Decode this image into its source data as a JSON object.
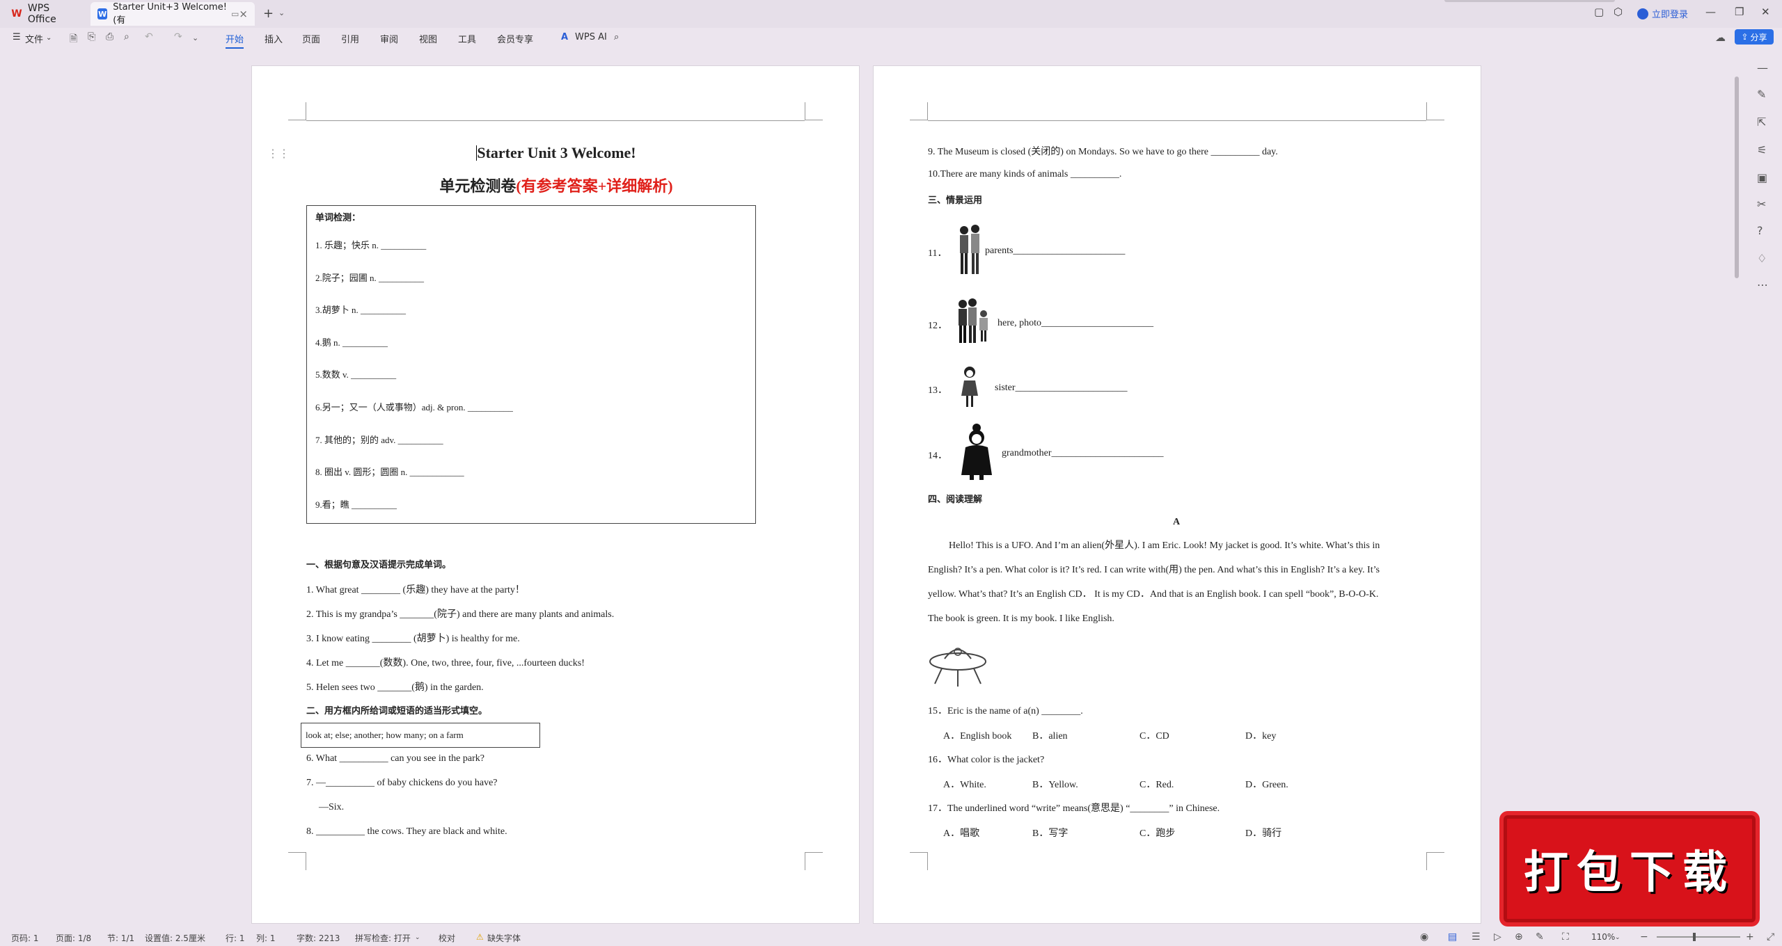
{
  "titlebar": {
    "app_tab": "WPS Office",
    "doc_tab": "Starter Unit+3 Welcome! (有",
    "login": "立即登录"
  },
  "menubar": {
    "file": "文件",
    "tabs": [
      "开始",
      "插入",
      "页面",
      "引用",
      "审阅",
      "视图",
      "工具",
      "会员专享"
    ],
    "active_tab": "开始",
    "wps_ai": "WPS AI",
    "share": "分享"
  },
  "page1": {
    "title": "Starter Unit 3 Welcome!",
    "subtitle_black": "单元检测卷",
    "subtitle_red": "(有参考答案+详细解析)",
    "vocab_heading": "单词检测：",
    "vocab_items": [
      "1.  乐趣；快乐 n. __________",
      "2.院子；园圃 n. __________",
      "3.胡萝卜 n. __________",
      "4.鹅 n. __________",
      "5.数数 v. __________",
      "6.另一；又一（人或事物）adj. & pron. __________",
      "7.  其他的；别的 adv.    __________",
      "8.  圈出  v.    圆形；圆圈  n. ____________",
      "9.看；瞧    __________"
    ],
    "section1_heading": "一、根据句意及汉语提示完成单词。",
    "section1_items": [
      "1. What great ________ (乐趣) they have at the party！",
      "2. This is my grandpa’s _______(院子) and there are many plants and animals.",
      "3. I know eating ________ (胡萝卜) is healthy for me.",
      "4. Let me _______(数数). One, two, three, four, five, ...fourteen ducks!",
      "5. Helen sees two _______(鹅) in the garden."
    ],
    "section2_heading": "二、用方框内所给词或短语的适当形式填空。",
    "phrase_box": "look at; else; another; how many; on a farm",
    "section2_items": [
      "6.  What __________ can you see in the park?",
      "7.  —__________ of baby chickens do you have?",
      "—Six.",
      "8.  __________ the cows. They are black and white."
    ]
  },
  "page2": {
    "top_items": [
      "9.  The Museum is closed (关闭的) on Mondays. So we have to go there __________ day.",
      "10.There are many kinds of animals __________."
    ],
    "section3_heading": "三、情景运用",
    "situations": [
      {
        "num": "11．",
        "text": "parents_______________________"
      },
      {
        "num": "12．",
        "text": "here, photo_______________________"
      },
      {
        "num": "13．",
        "text": "sister_______________________"
      },
      {
        "num": "14．",
        "text": "grandmother_______________________"
      }
    ],
    "section4_heading": "四、阅读理解",
    "passage_label": "A",
    "passage_lines": [
      "Hello! This is a UFO. And I’m an alien(外星人). I am Eric. Look! My jacket is good. It’s white. What’s this in",
      "English? It’s a pen. What color is it? It’s red. I can write with(用) the pen. And what’s this in English? It’s a key. It’s",
      "yellow. What’s that? It’s an English CD． It is my CD．And that is an English book. I can spell “book”, B-O-O-K.",
      "The book is green. It is my book. I like English."
    ],
    "questions": [
      {
        "q": "15．Eric is the name of a(n) ________.",
        "opts": [
          "A．English book",
          "B．alien",
          "C．CD",
          "D．key"
        ]
      },
      {
        "q": "16．What color is the jacket?",
        "opts": [
          "A．White.",
          "B．Yellow.",
          "C．Red.",
          "D．Green."
        ]
      },
      {
        "q": "17．The underlined word “write” means(意思是) “________” in Chinese.",
        "opts": [
          "A．唱歌",
          "B．写字",
          "C．跑步",
          "D．骑行"
        ]
      }
    ]
  },
  "statusbar": {
    "page_num": "页码: 1",
    "page_of": "页面: 1/8",
    "section": "节: 1/1",
    "setting": "设置值: 2.5厘米",
    "row": "行: 1",
    "col": "列: 1",
    "word_count": "字数: 2213",
    "spell_check": "拼写检查: 打开",
    "proofread": "校对",
    "missing_font": "缺失字体",
    "zoom": "110%"
  },
  "stamp": {
    "text": "打包下载"
  }
}
